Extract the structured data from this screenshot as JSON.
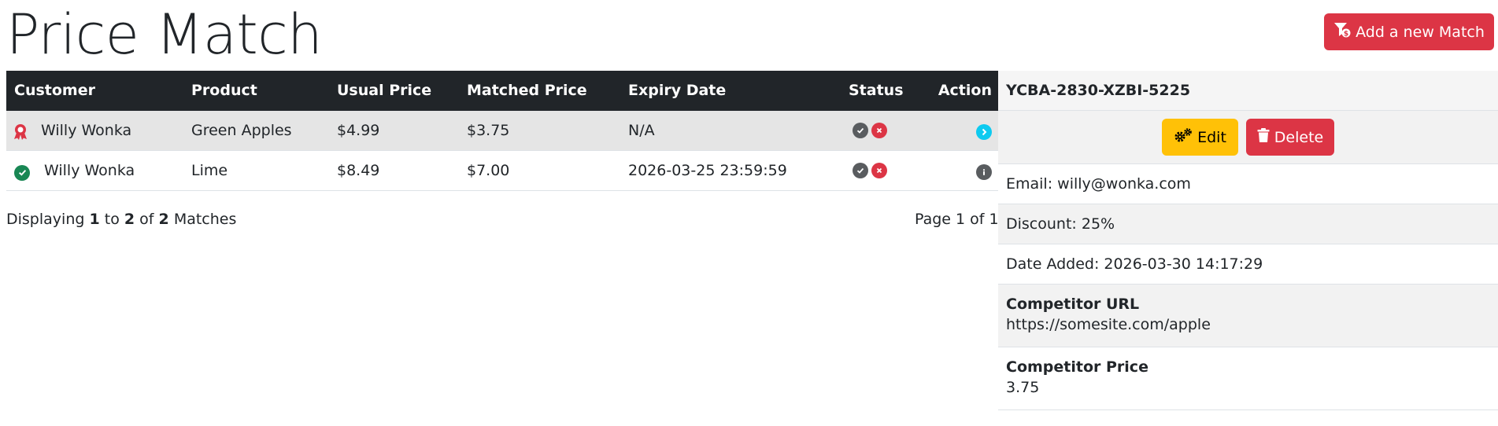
{
  "page": {
    "title": "Price Match",
    "add_button_label": "Add a new Match"
  },
  "colors": {
    "header_bg": "#212529",
    "accent_red": "#dc3545",
    "accent_yellow": "#ffc107",
    "accent_cyan": "#0dcaf0",
    "accent_green": "#198754"
  },
  "table": {
    "headers": [
      "Customer",
      "Product",
      "Usual Price",
      "Matched Price",
      "Expiry Date",
      "Status",
      "Action"
    ],
    "rows": [
      {
        "icon": "ribbon-award-icon",
        "customer": "Willy Wonka",
        "product": "Green Apples",
        "usual_price": "$4.99",
        "matched_price": "$3.75",
        "expiry": "N/A",
        "action_icon": "chevron-right-icon",
        "selected": true
      },
      {
        "icon": "check-circle-icon",
        "customer": "Willy Wonka",
        "product": "Lime",
        "usual_price": "$8.49",
        "matched_price": "$7.00",
        "expiry": "2026-03-25 23:59:59",
        "action_icon": "info-icon",
        "selected": false
      }
    ]
  },
  "pagination": {
    "prefix": "Displaying",
    "from": "1",
    "to_word": "to",
    "to": "2",
    "of_word": "of",
    "total": "2",
    "suffix": "Matches",
    "page_text": "Page 1 of 1"
  },
  "detail": {
    "code": "YCBA-2830-XZBI-5225",
    "edit_label": "Edit",
    "delete_label": "Delete",
    "email": "Email: willy@wonka.com",
    "discount": "Discount: 25%",
    "date_added": "Date Added: 2026-03-30 14:17:29",
    "competitor_url_label": "Competitor URL",
    "competitor_url": "https://somesite.com/apple",
    "competitor_price_label": "Competitor Price",
    "competitor_price": "3.75"
  }
}
